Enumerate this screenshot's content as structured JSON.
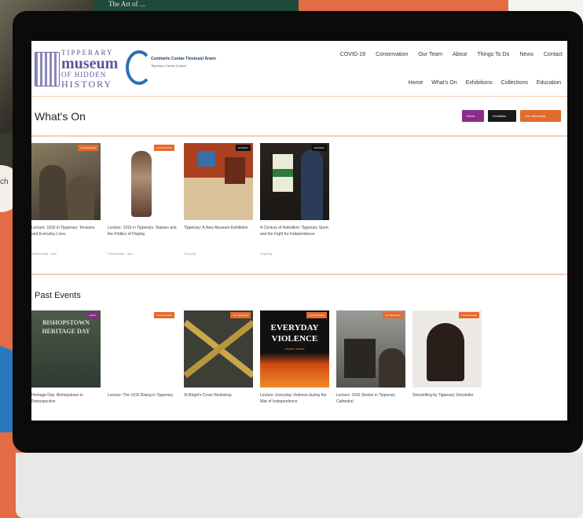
{
  "background": {
    "edge_text": "ch",
    "top_text": "The Art of ..."
  },
  "header": {
    "logo": {
      "line1": "TIPPERARY",
      "line2": "museum",
      "line3": "OF HIDDEN",
      "line4": "HISTORY"
    },
    "council": {
      "name": "Comhairle Contae Thiobraid Árann",
      "sub": "Tipperary County Council"
    },
    "top_nav": [
      "COVID-19",
      "Conservation",
      "Our Team",
      "About",
      "Things To Do",
      "News",
      "Contact"
    ],
    "main_nav": [
      "Home",
      "What's On",
      "Exhibitions",
      "Collections",
      "Education"
    ]
  },
  "whats_on": {
    "title": "What's On",
    "filters": [
      "Event",
      "Exhibition",
      "Live Workshop"
    ],
    "cards": [
      {
        "tag": "Live Workshop",
        "title": "Lecture: 1916 in Tipperary: Tensions and Everyday Lives",
        "date": "Wednesday · 6pm"
      },
      {
        "tag": "Live Workshop",
        "title": "Lecture: 1916 in Tipperary: Statues and the Politics of Display",
        "date": "Wednesday · 6pm"
      },
      {
        "tag": "Exhibition",
        "title": "Tipperary: A New Museum Exhibition",
        "date": "Ongoing"
      },
      {
        "tag": "Exhibition",
        "title": "A Century of Rebellion: Tipperary Sport and the Fight for Independence",
        "date": "Ongoing"
      }
    ]
  },
  "past_events": {
    "title": "Past Events",
    "cards": [
      {
        "tag": "Event",
        "thumb_text": "BISHOPSTOWN HERITAGE DAY",
        "title": "Heritage Day: Bishopstown in Retrospective",
        "date": ""
      },
      {
        "tag": "Live Workshop",
        "title": "Lecture: The 1916 Rising in Tipperary",
        "date": ""
      },
      {
        "tag": "Live Workshop",
        "title": "St Brigid's Cross Workshop",
        "date": ""
      },
      {
        "tag": "Live Workshop",
        "thumb_text_1": "EVERYDAY",
        "thumb_text_2": "VIOLENCE",
        "thumb_text_3": "Lecture series",
        "title": "Lecture: Everyday Violence during the War of Independence",
        "date": ""
      },
      {
        "tag": "Live Workshop",
        "title": "Lecture: 1916 Stories in Tipperary Cathedral",
        "date": ""
      },
      {
        "tag": "Live Workshop",
        "title": "Storytelling by Tipperary Storyteller",
        "date": ""
      }
    ]
  }
}
